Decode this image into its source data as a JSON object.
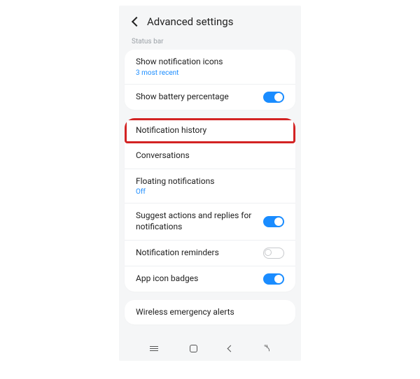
{
  "header": {
    "title": "Advanced settings"
  },
  "section_status_bar": {
    "label": "Status bar",
    "items": [
      {
        "title": "Show notification icons",
        "sub": "3 most recent",
        "sub_style": "blue",
        "toggle": null
      },
      {
        "title": "Show battery percentage",
        "sub": null,
        "toggle": "on"
      }
    ]
  },
  "section_main": {
    "items": [
      {
        "title": "Notification history",
        "sub": null,
        "toggle": null,
        "highlight": true
      },
      {
        "title": "Conversations",
        "sub": null,
        "toggle": null
      },
      {
        "title": "Floating notifications",
        "sub": "Off",
        "sub_style": "blue",
        "toggle": null
      },
      {
        "title": "Suggest actions and replies for notifications",
        "sub": null,
        "toggle": "on"
      },
      {
        "title": "Notification reminders",
        "sub": null,
        "toggle": "off"
      },
      {
        "title": "App icon badges",
        "sub": null,
        "toggle": "on"
      }
    ]
  },
  "section_extra": {
    "items": [
      {
        "title": "Wireless emergency alerts",
        "sub": null,
        "toggle": null
      }
    ]
  }
}
